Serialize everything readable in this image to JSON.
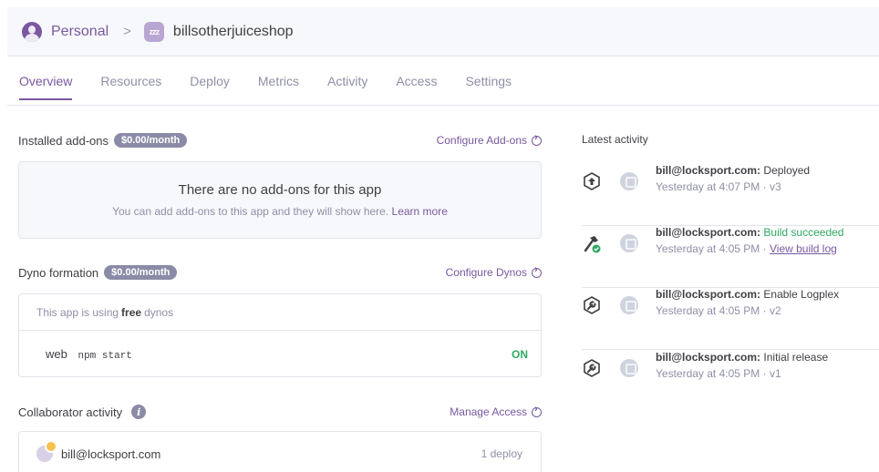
{
  "breadcrumb": {
    "personal_label": "Personal",
    "separator": ">",
    "app_icon_text": "zzz",
    "app_name": "billsotherjuiceshop"
  },
  "tabs": [
    {
      "label": "Overview",
      "active": true
    },
    {
      "label": "Resources",
      "active": false
    },
    {
      "label": "Deploy",
      "active": false
    },
    {
      "label": "Metrics",
      "active": false
    },
    {
      "label": "Activity",
      "active": false
    },
    {
      "label": "Access",
      "active": false
    },
    {
      "label": "Settings",
      "active": false
    }
  ],
  "addons": {
    "title": "Installed add-ons",
    "price_badge": "$0.00/month",
    "configure_link": "Configure Add-ons",
    "empty_title": "There are no add-ons for this app",
    "empty_subtitle": "You can add add-ons to this app and they will show here.",
    "learn_more": "Learn more"
  },
  "dynos": {
    "title": "Dyno formation",
    "price_badge": "$0.00/month",
    "configure_link": "Configure Dynos",
    "info_prefix": "This app is using",
    "info_bold": "free",
    "info_suffix": "dynos",
    "rows": [
      {
        "name": "web",
        "command": "npm start",
        "status": "ON"
      }
    ]
  },
  "collaborators": {
    "title": "Collaborator activity",
    "manage_link": "Manage Access",
    "rows": [
      {
        "email": "bill@locksport.com",
        "count": "1 deploy"
      }
    ]
  },
  "activity": {
    "title": "Latest activity",
    "items": [
      {
        "icon": "deploy-icon",
        "user": "bill@locksport.com:",
        "action": "Deployed",
        "success": false,
        "time": "Yesterday at 4:07 PM",
        "tail": "· v3",
        "link": ""
      },
      {
        "icon": "build-success-icon",
        "user": "bill@locksport.com:",
        "action": "Build succeeded",
        "success": true,
        "time": "Yesterday at 4:05 PM",
        "tail": "·",
        "link": "View build log"
      },
      {
        "icon": "wrench-icon",
        "user": "bill@locksport.com:",
        "action": "Enable Logplex",
        "success": false,
        "time": "Yesterday at 4:05 PM",
        "tail": "· v2",
        "link": ""
      },
      {
        "icon": "wrench-icon",
        "user": "bill@locksport.com:",
        "action": "Initial release",
        "success": false,
        "time": "Yesterday at 4:05 PM",
        "tail": "· v1",
        "link": ""
      }
    ]
  },
  "colors": {
    "accent": "#79589f",
    "success": "#2ea961",
    "muted": "#8f8fa8",
    "badge": "#8b8ba7"
  }
}
